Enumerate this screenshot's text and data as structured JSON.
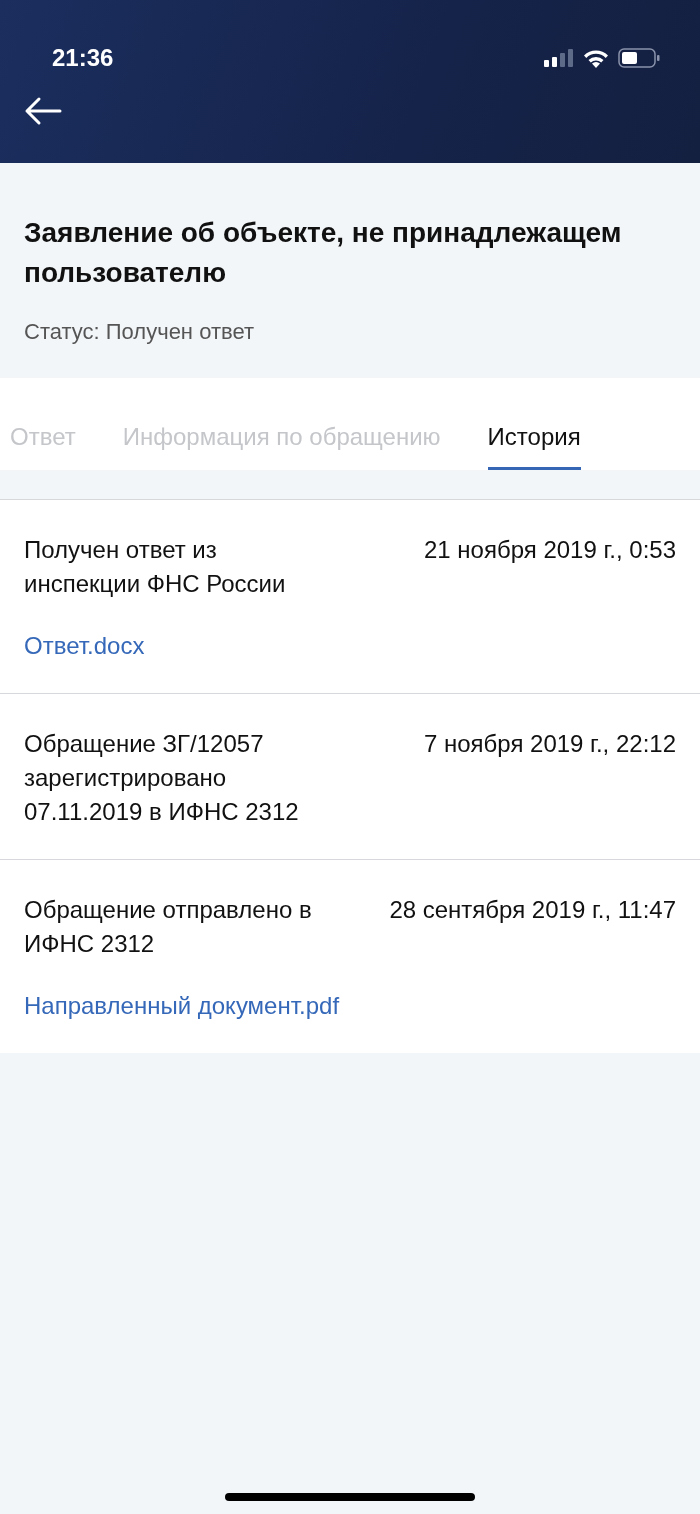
{
  "status_bar": {
    "time": "21:36"
  },
  "title": "Заявление об объекте, не принадлежащем пользователю",
  "status": "Статус: Получен ответ",
  "tabs": [
    {
      "label": "Ответ",
      "selected": false
    },
    {
      "label": "Информация по обращению",
      "selected": false
    },
    {
      "label": "История",
      "selected": true
    }
  ],
  "history": [
    {
      "text": "Получен ответ из инспекции ФНС России",
      "date": "21 ноября 2019 г., 0:53",
      "attachment": "Ответ.docx"
    },
    {
      "text": "Обращение ЗГ/12057 зарегистрировано 07.11.2019 в ИФНС 2312",
      "date": "7 ноября 2019 г., 22:12"
    },
    {
      "text": "Обращение отправлено в ИФНС 2312",
      "date": "28 сентября 2019 г., 11:47",
      "attachment": "Направленный документ.pdf"
    }
  ]
}
